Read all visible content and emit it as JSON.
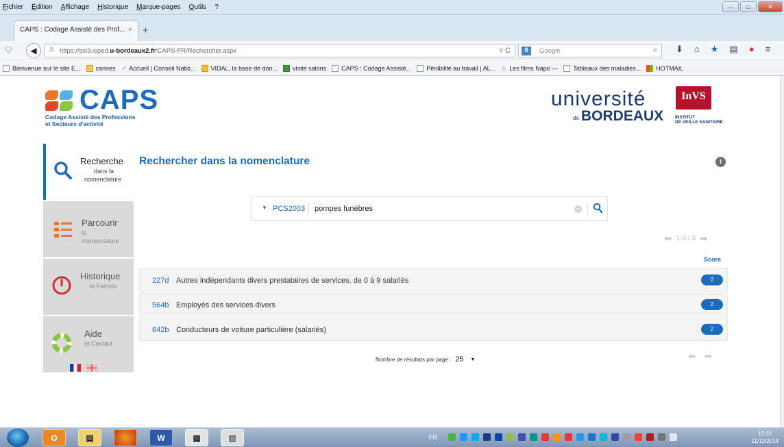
{
  "browser": {
    "menu": [
      "Fichier",
      "Édition",
      "Affichage",
      "Historique",
      "Marque-pages",
      "Outils",
      "?"
    ],
    "tab_title": "CAPS : Codage Assisté des Prof...",
    "tab_close": "×",
    "new_tab": "+",
    "url_prefix": "https://ssl3.isped.",
    "url_host": "u-bordeaux2.fr",
    "url_path": "/CAPS-FR/Rechercher.aspx",
    "search_engine_badge": "8",
    "search_placeholder": "Google"
  },
  "bookmarks": [
    {
      "label": "Bienvenue sur le site E...",
      "icon": "page-icon"
    },
    {
      "label": "cannes",
      "icon": "folder-icon"
    },
    {
      "label": "Accueil | Conseil Natio...",
      "icon": "arrow-icon"
    },
    {
      "label": "VIDAL, la base de don...",
      "icon": "vidal-icon"
    },
    {
      "label": "visite salons",
      "icon": "sheet-icon"
    },
    {
      "label": "CAPS : Codage Assisté...",
      "icon": "page-icon"
    },
    {
      "label": "Pénibilité au travail | AL...",
      "icon": "page-icon"
    },
    {
      "label": "Les films Napo —",
      "icon": "person-icon"
    },
    {
      "label": "Tableaux des maladies...",
      "icon": "page-icon"
    },
    {
      "label": "HOTMAIL",
      "icon": "ms-icon"
    }
  ],
  "header": {
    "caps_logo": "CAPS",
    "caps_tagline_1": "Codage Assisté des Professions",
    "caps_tagline_2": "et Secteurs d'activité",
    "ub_line1": "université",
    "ub_de": "de",
    "ub_line2": "BORDEAUX",
    "invs_logo": "InVS",
    "invs_line1": "INSTITUT",
    "invs_line2": "DE VEILLE SANITAIRE"
  },
  "sidebar": {
    "items": [
      {
        "title": "Recherche",
        "sub1": "dans la",
        "sub2": "nomenclature"
      },
      {
        "title": "Parcourir",
        "sub1": "la",
        "sub2": "nomenclature"
      },
      {
        "title": "Historique",
        "sub1": "et Favoris",
        "sub2": ""
      },
      {
        "title": "Aide",
        "sub1": "et Contact",
        "sub2": ""
      }
    ]
  },
  "main": {
    "title": "Rechercher dans la nomenclature",
    "info_icon_label": "i",
    "nomenclature": "PCS2003",
    "query": "pompes funèbres",
    "range": "1-3 / 3",
    "score_header": "Score",
    "results": [
      {
        "code": "227d",
        "label": "Autres indépendants divers prestataires de services, de 0 à 9 salariés",
        "score": "2"
      },
      {
        "code": "564b",
        "label": "Employés des services divers",
        "score": "2"
      },
      {
        "code": "642b",
        "label": "Conducteurs de voiture particulière (salariés)",
        "score": "2"
      }
    ],
    "per_page_label": "Nombre de résultats par page :",
    "per_page_value": "25"
  },
  "taskbar": {
    "lang": "FR",
    "time": "15:31",
    "date": "11/12/2014"
  },
  "colors": {
    "accent": "#1d6bbd",
    "invs_red": "#b5122b"
  }
}
